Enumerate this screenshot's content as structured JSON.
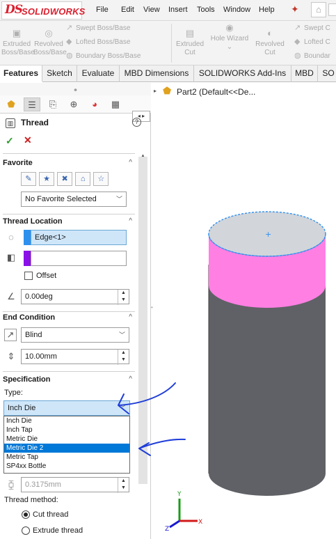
{
  "app": {
    "logo_ds": "DS",
    "logo_text": "SOLIDWORKS",
    "menus": [
      "File",
      "Edit",
      "View",
      "Insert",
      "Tools",
      "Window",
      "Help"
    ]
  },
  "cmd": {
    "extruded_boss": [
      "Extruded",
      "Boss/Base"
    ],
    "revolved_boss": [
      "Revolved",
      "Boss/Base"
    ],
    "swept_boss": "Swept Boss/Base",
    "lofted_boss": "Lofted Boss/Base",
    "boundary_boss": "Boundary Boss/Base",
    "extruded_cut": [
      "Extruded",
      "Cut"
    ],
    "hole_wizard": "Hole Wizard",
    "revolved_cut": [
      "Revolved",
      "Cut"
    ],
    "swept_cut": "Swept C",
    "lofted_cut": "Lofted C",
    "boundary_cut": "Boundar"
  },
  "tabs": [
    "Features",
    "Sketch",
    "Evaluate",
    "MBD Dimensions",
    "SOLIDWORKS Add-Ins",
    "MBD",
    "SO"
  ],
  "pm": {
    "title": "Thread",
    "favorite": {
      "header": "Favorite",
      "selected": "No Favorite Selected"
    },
    "thread_location": {
      "header": "Thread Location",
      "edge": "Edge<1>",
      "face": "",
      "offset_label": "Offset",
      "angle": "0.00deg"
    },
    "end_condition": {
      "header": "End Condition",
      "type": "Blind",
      "depth": "10.00mm"
    },
    "specification": {
      "header": "Specification",
      "type_label": "Type:",
      "type_value": "Inch Die",
      "options": [
        "Inch Die",
        "Inch Tap",
        "Metric Die",
        "Metric Die 2",
        "Metric Tap",
        "SP4xx Bottle"
      ],
      "highlighted_index": 3,
      "pitch": "0.3175mm"
    },
    "thread_method": {
      "label": "Thread method:",
      "cut": "Cut thread",
      "extrude": "Extrude thread"
    }
  },
  "tree": {
    "label": "Part2  (Default<<De..."
  },
  "triad": {
    "x": "X",
    "y": "Y",
    "z": "Z"
  },
  "colors": {
    "accent_red": "#d9202f",
    "thread_face": "#ff7fe3",
    "cylinder_body": "#5f6166",
    "selection_blue": "#0078d7",
    "annotation_blue": "#1f3ed8"
  }
}
